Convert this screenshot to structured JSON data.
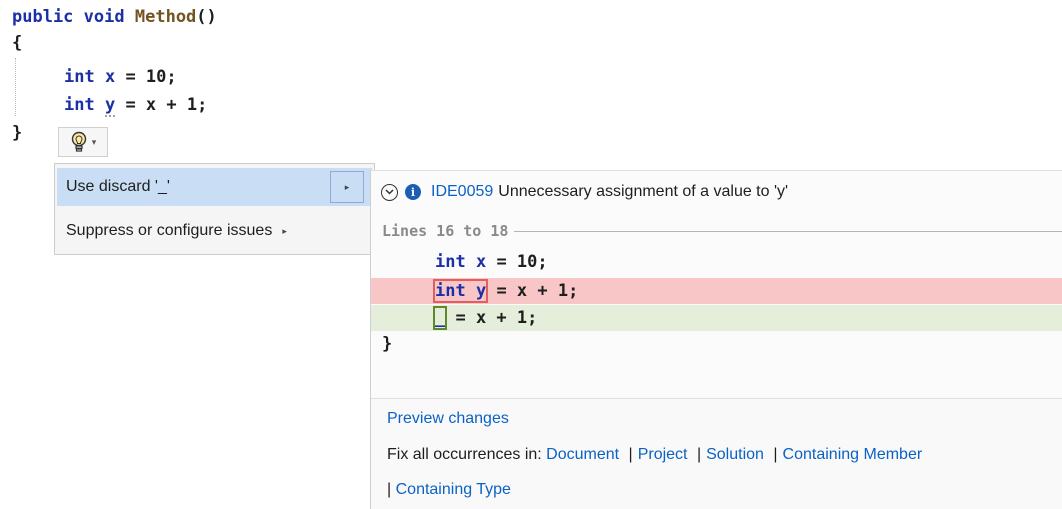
{
  "editor": {
    "line1": {
      "kw1": "public",
      "kw2": "void",
      "name": "Method",
      "rest": "()"
    },
    "line2": "{",
    "line3": {
      "kw": "int",
      "var": "x",
      "rest": " = 10;"
    },
    "line4": {
      "kw": "int",
      "var": "y",
      "rest": " = x + 1;"
    },
    "line5": "}"
  },
  "lightbulb": {
    "icon": "lightbulb-icon",
    "dropdown_icon": "chevron-down-icon"
  },
  "quick_actions_menu": {
    "items": [
      {
        "label": "Use discard '_'",
        "selected": true,
        "has_submenu": true
      },
      {
        "label": "Suppress or configure issues",
        "selected": false,
        "has_submenu": true
      }
    ],
    "submenu_arrow": "▸"
  },
  "preview_pane": {
    "diagnostic_id": "IDE0059",
    "diagnostic_message": "Unnecessary assignment of a value to 'y'",
    "lines_header": "Lines 16 to 18",
    "code": {
      "line1": {
        "kw": "int",
        "var": "x",
        "rest": " = 10;"
      },
      "removed": {
        "kw": "int",
        "var": "y",
        "rest": " = x + 1;"
      },
      "added": {
        "discard": "_",
        "rest": " = x + 1;"
      },
      "close": "}"
    },
    "preview_changes_link": "Preview changes",
    "fix_all_label": "Fix all occurrences in:",
    "fix_all_scopes": [
      "Document",
      "Project",
      "Solution",
      "Containing Member",
      "Containing Type"
    ],
    "separator": "|",
    "colors": {
      "removed_bg": "#f8c6c6",
      "added_bg": "#e5eedb",
      "link": "#0b62c4"
    }
  }
}
